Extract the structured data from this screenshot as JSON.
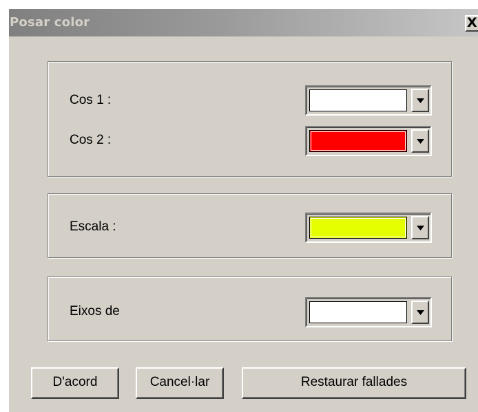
{
  "window": {
    "title": "Posar color",
    "close_label": "X"
  },
  "groups": {
    "cos": {
      "rows": [
        {
          "label": "Cos 1 :",
          "color": "#ffffff"
        },
        {
          "label": "Cos 2 :",
          "color": "#ff0000"
        }
      ]
    },
    "escala": {
      "label": "Escala :",
      "color": "#e6ff00"
    },
    "eixos": {
      "label": "Eixos de",
      "color": "#ffffff"
    }
  },
  "buttons": {
    "ok": "D'acord",
    "cancel": "Cancel·lar",
    "restore": "Restaurar fallades"
  },
  "icons": {
    "dropdown": "triangle-down-icon",
    "close": "close-icon"
  }
}
